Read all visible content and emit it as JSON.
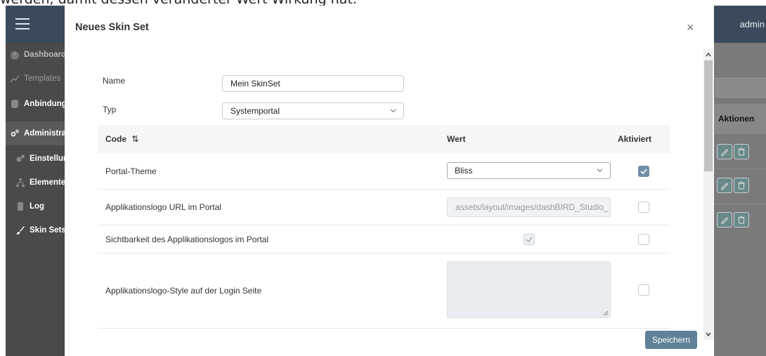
{
  "hint_text": "werden, damit dessen veränderter Wert Wirkung hat.",
  "app": {
    "user": "admin",
    "sidebar": [
      {
        "label": "Dashboard",
        "icon": "dashboard-icon"
      },
      {
        "label": "Templates",
        "icon": "chart-icon"
      },
      {
        "label": "Anbindungen",
        "icon": "database-icon"
      },
      {
        "label": "Administration",
        "icon": "cogs-icon"
      },
      {
        "label": "Einstellungen",
        "icon": "cogs-icon"
      },
      {
        "label": "Elemente",
        "icon": "sitemap-icon"
      },
      {
        "label": "Log",
        "icon": "file-icon"
      },
      {
        "label": "Skin Sets",
        "icon": "brush-icon"
      }
    ],
    "table_header_actions": "Aktionen"
  },
  "modal": {
    "title": "Neues Skin Set",
    "close_label": "×",
    "name_label": "Name",
    "name_value": "Mein SkinSet",
    "type_label": "Typ",
    "type_value": "Systemportal",
    "columns": {
      "code": "Code",
      "sort_icon": "⇅",
      "wert": "Wert",
      "aktiviert": "Aktiviert"
    },
    "rows": [
      {
        "code": "Portal-Theme",
        "wert": "Bliss",
        "kind": "select",
        "aktiviert": true
      },
      {
        "code": "Applikationslogo URL im Portal",
        "wert": "assets/layout/images/dashBIRD_Studio_",
        "kind": "text-disabled",
        "aktiviert": false
      },
      {
        "code": "Sichtbarkeit des Applikationslogos im Portal",
        "wert": true,
        "kind": "checkbox-disabled",
        "aktiviert": false
      },
      {
        "code": "Applikationslogo-Style auf der Login Seite",
        "wert": "",
        "kind": "textarea",
        "aktiviert": false
      }
    ],
    "save_label": "Speichern"
  }
}
